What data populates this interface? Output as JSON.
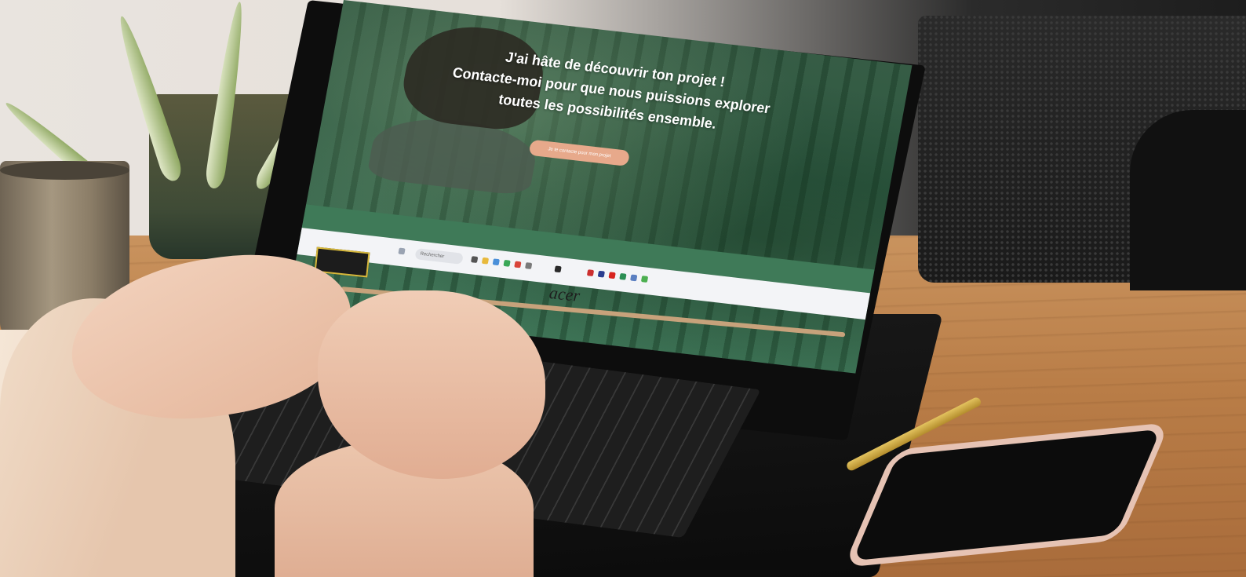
{
  "hero": {
    "line1": "J'ai hâte de découvrir ton projet !",
    "line2": "Contacte-moi pour que nous puissions explorer",
    "line3": "toutes les possibilités ensemble.",
    "cta_label": "Je te contacte pour mon projet"
  },
  "taskbar": {
    "search_placeholder": "Rechercher"
  },
  "laptop": {
    "brand": "acer"
  },
  "colors": {
    "cta": "#e7a98b",
    "forest_band": "#3f7a58",
    "desk": "#b97d47"
  }
}
